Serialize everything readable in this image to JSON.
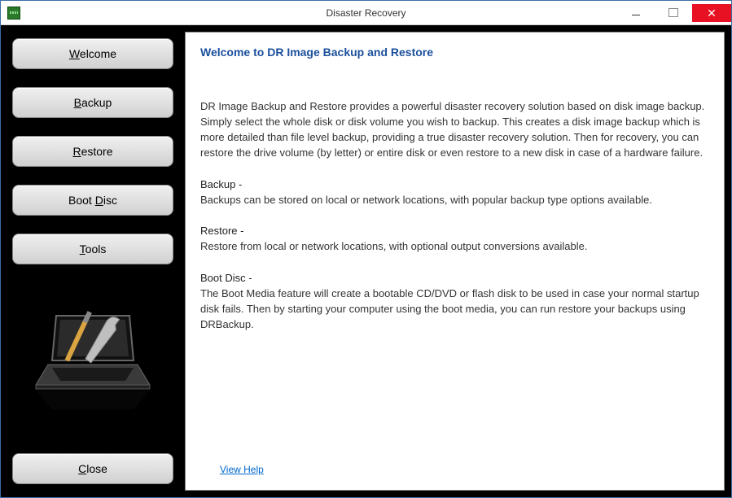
{
  "window": {
    "title": "Disaster Recovery"
  },
  "sidebar": {
    "buttons": {
      "welcome": {
        "pre": "",
        "mnemonic": "W",
        "post": "elcome"
      },
      "backup": {
        "pre": "",
        "mnemonic": "B",
        "post": "ackup"
      },
      "restore": {
        "pre": "",
        "mnemonic": "R",
        "post": "estore"
      },
      "bootdisc": {
        "pre": "Boot ",
        "mnemonic": "D",
        "post": "isc"
      },
      "tools": {
        "pre": "",
        "mnemonic": "T",
        "post": "ools"
      },
      "close": {
        "pre": "",
        "mnemonic": "C",
        "post": "lose"
      }
    }
  },
  "content": {
    "heading": "Welcome to DR Image Backup and Restore",
    "intro": "DR Image Backup and Restore provides a powerful disaster recovery solution based on disk image backup. Simply select the whole disk or disk volume you wish to backup. This creates a disk image backup which is more detailed than file level backup, providing a true disaster recovery solution. Then for recovery, you can restore the drive volume (by letter) or entire disk or even restore to a new disk in case of a hardware failure.",
    "backup_label": "Backup -",
    "backup_text": "Backups can be stored on local or network locations, with popular backup type options available.",
    "restore_label": "Restore -",
    "restore_text": "Restore from local or network locations, with optional output conversions available.",
    "bootdisc_label": "Boot Disc -",
    "bootdisc_text": "The Boot Media feature will create a bootable CD/DVD or flash disk to be used in case your normal startup disk fails. Then by starting your computer using the boot media, you can run restore your backups using DRBackup.",
    "help_link": "View Help"
  }
}
